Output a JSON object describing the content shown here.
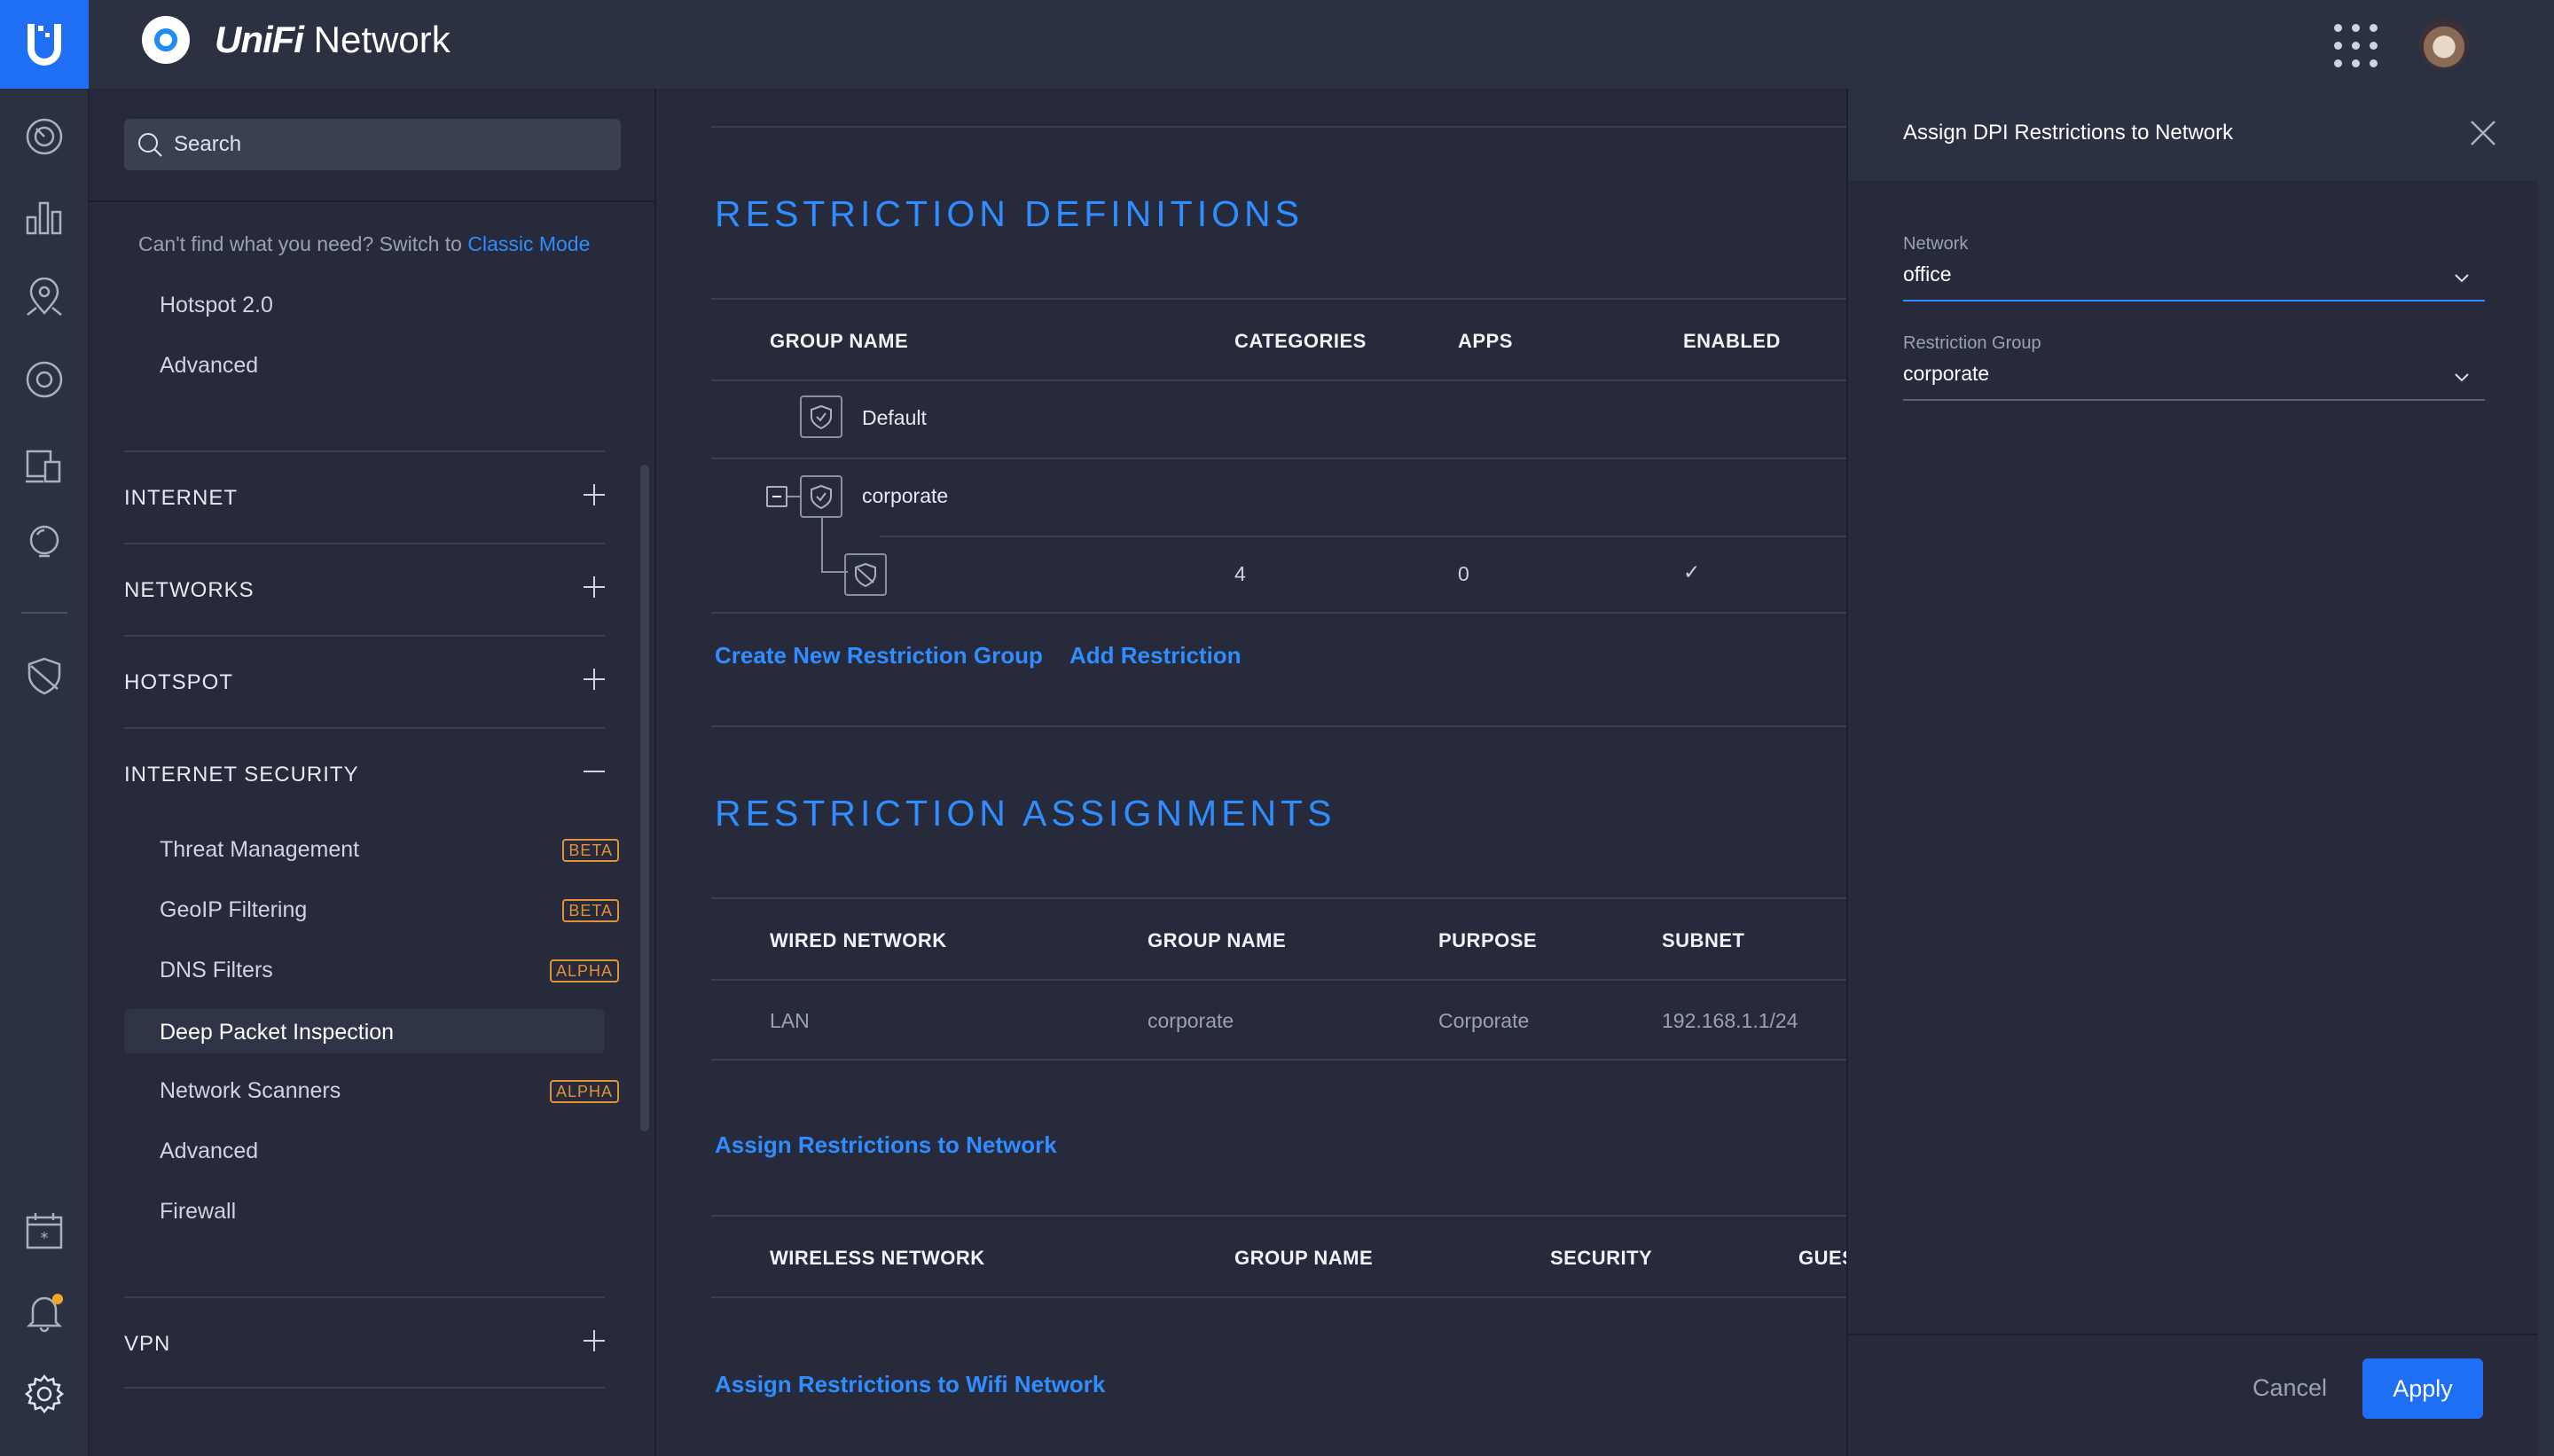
{
  "app": {
    "brand_bold": "UniFi",
    "brand_rest": " Network"
  },
  "sidebar": {
    "search_placeholder": "Search",
    "classic_prefix": "Can't find what you need? Switch to ",
    "classic_link": "Classic Mode",
    "top_items": [
      "Hotspot 2.0",
      "Advanced"
    ],
    "sections": [
      "INTERNET",
      "NETWORKS",
      "HOTSPOT",
      "INTERNET SECURITY",
      "VPN"
    ],
    "security_items": [
      {
        "label": "Threat Management",
        "badge": "BETA"
      },
      {
        "label": "GeoIP Filtering",
        "badge": "BETA"
      },
      {
        "label": "DNS Filters",
        "badge": "ALPHA"
      },
      {
        "label": "Deep Packet Inspection",
        "badge": ""
      },
      {
        "label": "Network Scanners",
        "badge": "ALPHA"
      },
      {
        "label": "Advanced",
        "badge": ""
      },
      {
        "label": "Firewall",
        "badge": ""
      }
    ]
  },
  "definitions": {
    "title": "RESTRICTION DEFINITIONS",
    "columns": [
      "GROUP NAME",
      "CATEGORIES",
      "APPS",
      "ENABLED"
    ],
    "rows": [
      {
        "name": "Default"
      },
      {
        "name": "corporate"
      },
      {
        "categories": "4",
        "apps": "0",
        "enabled": "✓"
      }
    ],
    "create_link": "Create New Restriction Group",
    "add_link": "Add Restriction"
  },
  "assignments": {
    "title": "RESTRICTION ASSIGNMENTS",
    "wired_columns": [
      "WIRED NETWORK",
      "GROUP NAME",
      "PURPOSE",
      "SUBNET"
    ],
    "wired_rows": [
      {
        "network": "LAN",
        "group": "corporate",
        "purpose": "Corporate",
        "subnet": "192.168.1.1/24"
      }
    ],
    "assign_link": "Assign Restrictions to Network",
    "wireless_columns": [
      "WIRELESS NETWORK",
      "GROUP NAME",
      "SECURITY",
      "GUES"
    ],
    "assign_wifi_link": "Assign Restrictions to Wifi Network"
  },
  "panel": {
    "title": "Assign DPI Restrictions to Network",
    "network_label": "Network",
    "network_value": "office",
    "group_label": "Restriction Group",
    "group_value": "corporate",
    "cancel": "Cancel",
    "apply": "Apply"
  },
  "colors": {
    "accent": "#2f8dff",
    "primary_button": "#1f6ff5",
    "badge": "#e0923a",
    "notification_dot": "#f5a623"
  }
}
